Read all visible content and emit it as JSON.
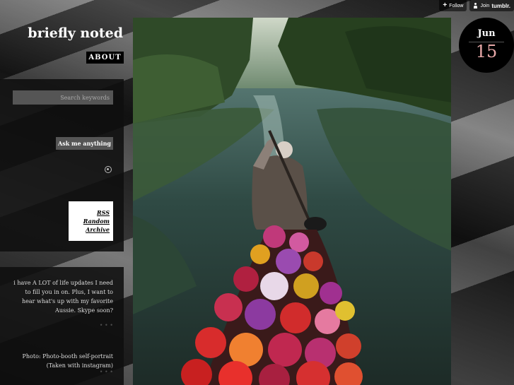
{
  "tumblr_bar": {
    "follow_label": "Follow",
    "join_label": "Join",
    "join_brand": "tumblr."
  },
  "blog": {
    "title": "briefly noted",
    "about_label": "ABOUT"
  },
  "sidebar": {
    "search_placeholder": "Search keywords",
    "ask_label": "Ask me anything",
    "links": [
      {
        "label": "RSS"
      },
      {
        "label": "Random"
      },
      {
        "label": "Archive"
      }
    ]
  },
  "posts": [
    {
      "text": "i have A LOT of life updates I need to fill you in on. Plus, I want to hear what's up with my favorite Aussie. Skype soon?"
    },
    {
      "text": "Photo: Photo-booth self-portrait (Taken with instagram)"
    }
  ],
  "date": {
    "month": "Jun",
    "day": "15"
  },
  "colors": {
    "date_day": "#e8a8a8",
    "about_bg": "#000000",
    "panel_bg": "#0f0f0f"
  }
}
